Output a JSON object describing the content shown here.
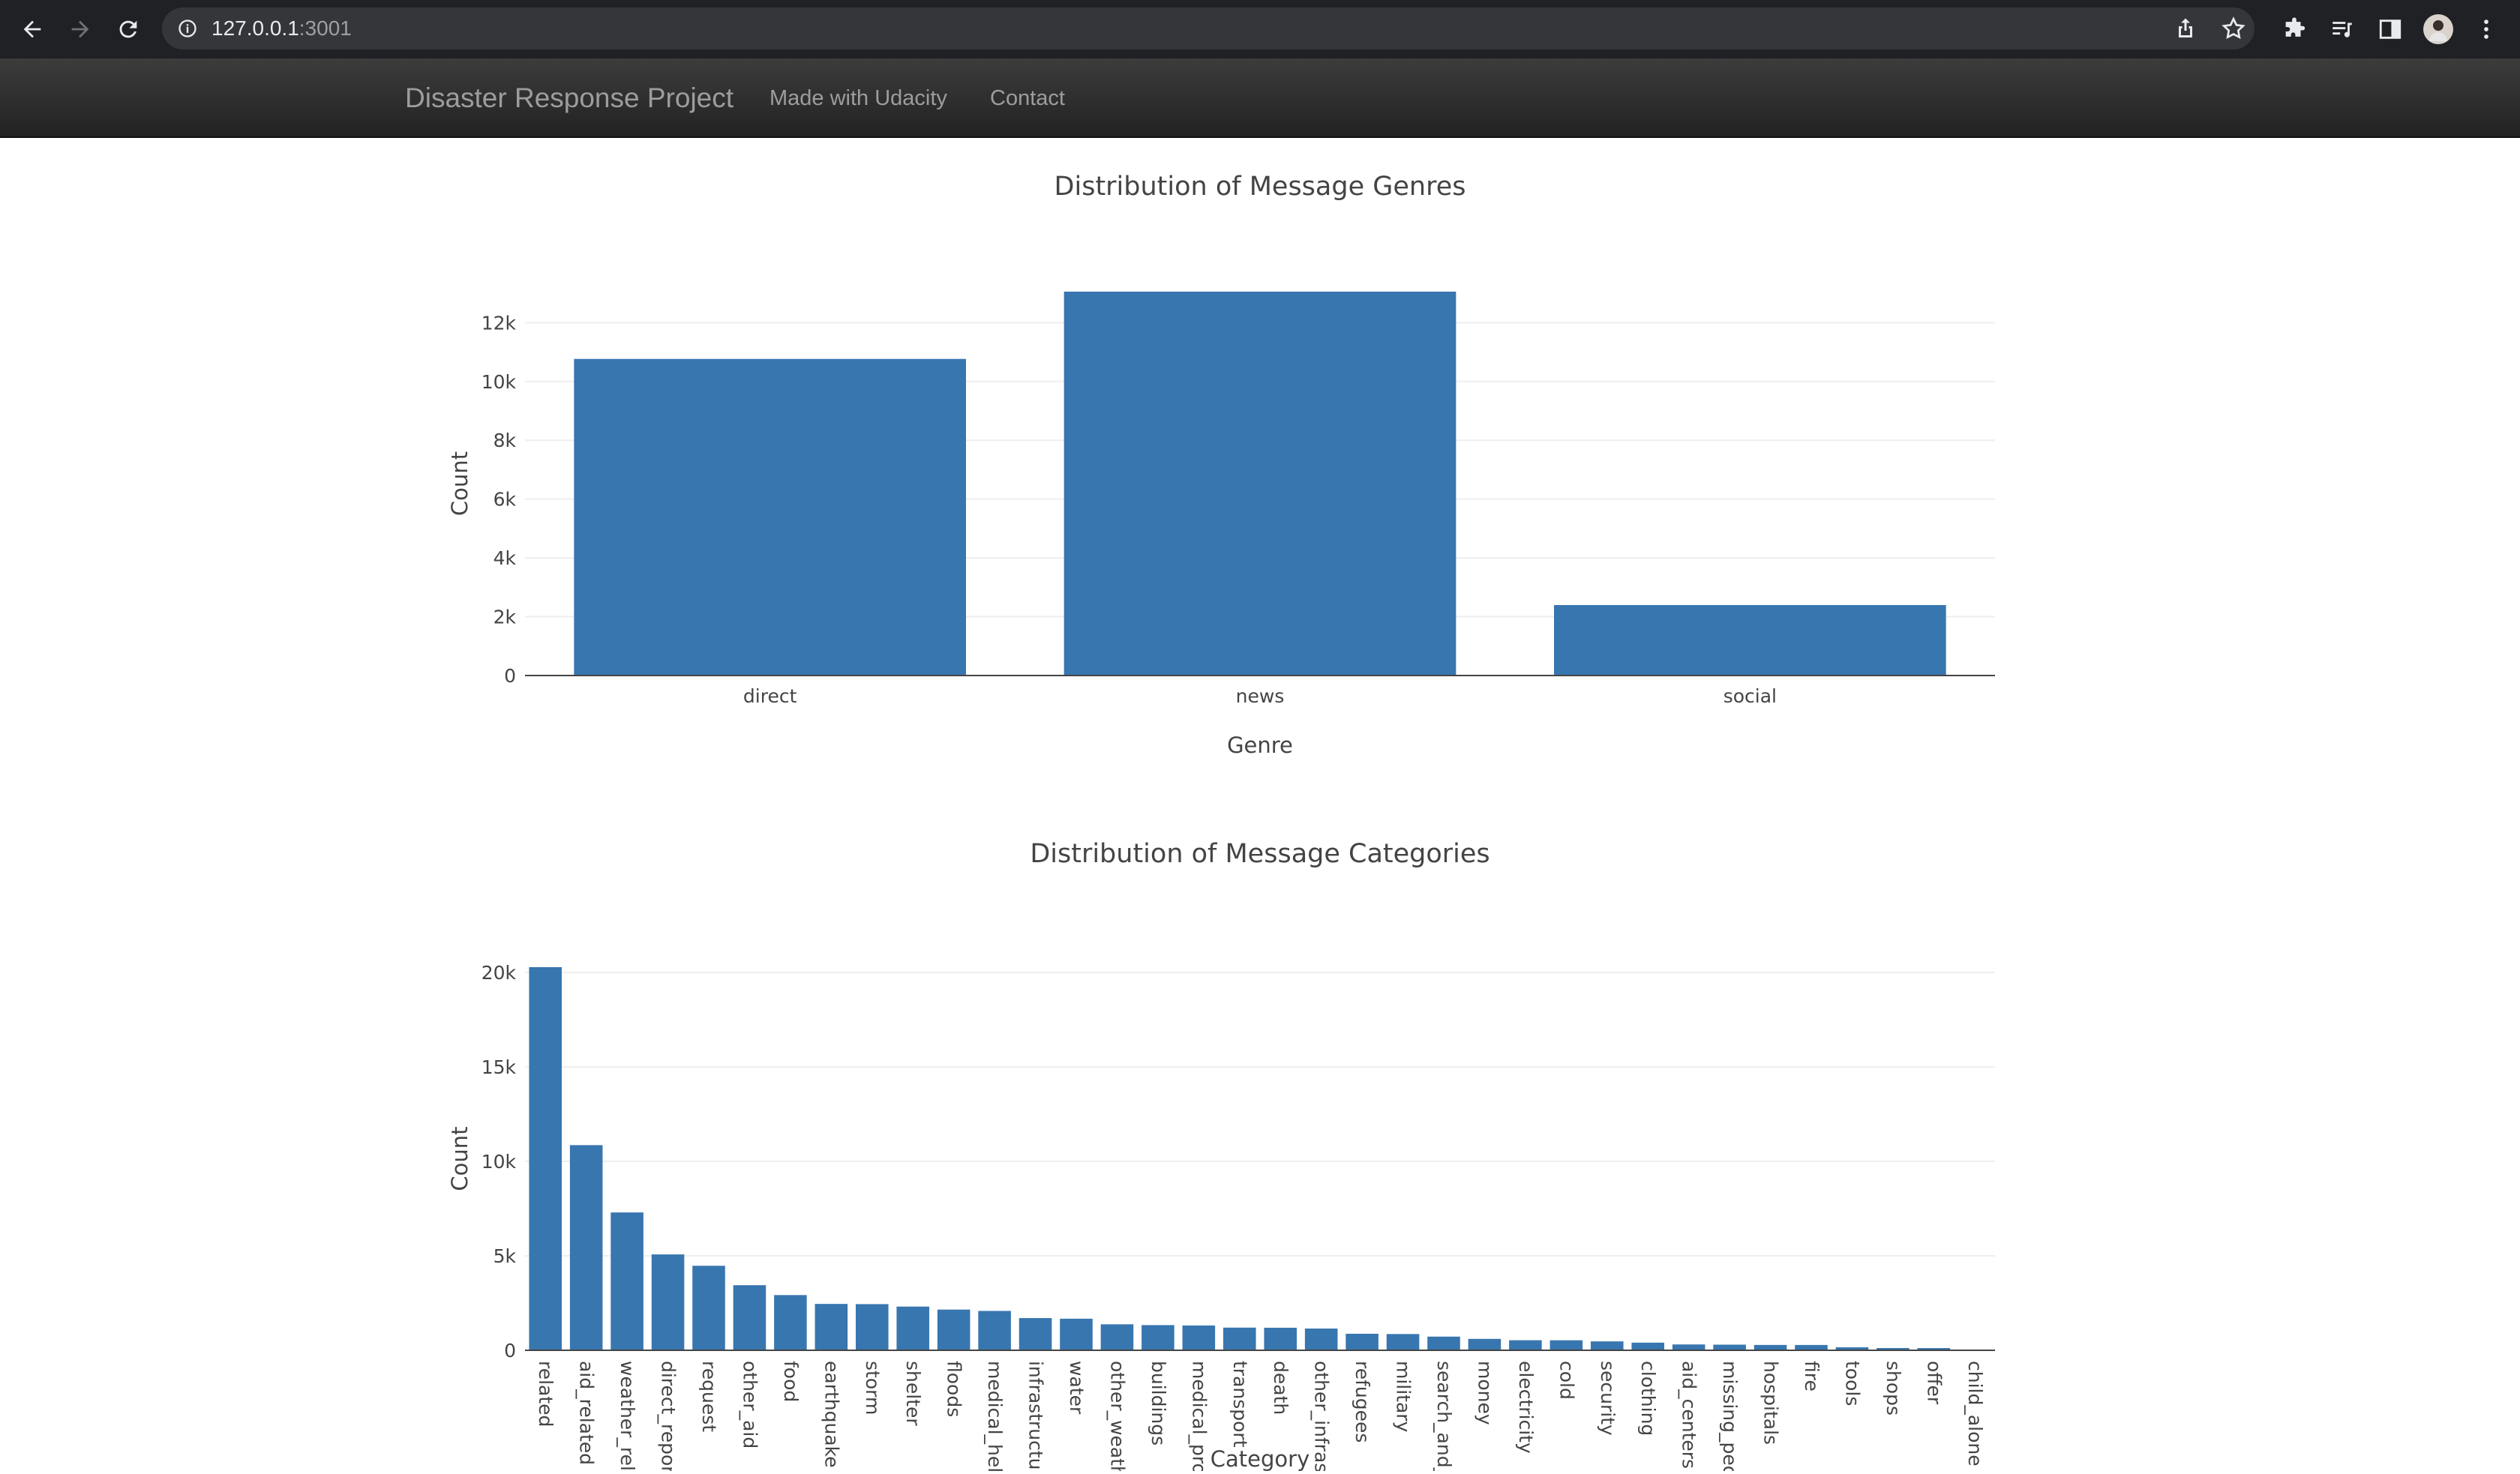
{
  "browser": {
    "url_host": "127.0.0.1",
    "url_port": ":3001",
    "icons": [
      "back-arrow-icon",
      "forward-arrow-icon",
      "reload-icon",
      "info-icon",
      "share-icon",
      "star-icon",
      "extensions-icon",
      "media-icon",
      "sidepanel-icon",
      "profile-avatar",
      "menu-dots-icon"
    ]
  },
  "navbar": {
    "brand": "Disaster Response Project",
    "links": [
      "Made with Udacity",
      "Contact"
    ]
  },
  "colors": {
    "bar": "#3876af",
    "grid": "#eeeeee",
    "axis": "#444444"
  },
  "chart_data": [
    {
      "type": "bar",
      "title": "Distribution of Message Genres",
      "xlabel": "Genre",
      "ylabel": "Count",
      "categories": [
        "direct",
        "news",
        "social"
      ],
      "values": [
        10766,
        13054,
        2396
      ],
      "ylim": [
        0,
        13054
      ],
      "yticks": [
        0,
        2000,
        4000,
        6000,
        8000,
        10000,
        12000
      ],
      "ytick_labels": [
        "0",
        "2k",
        "4k",
        "6k",
        "8k",
        "10k",
        "12k"
      ],
      "grid": true
    },
    {
      "type": "bar",
      "title": "Distribution of Message Categories",
      "xlabel": "Category",
      "ylabel": "Count",
      "categories": [
        "related",
        "aid_related",
        "weather_related",
        "direct_report",
        "request",
        "other_aid",
        "food",
        "earthquake",
        "storm",
        "shelter",
        "floods",
        "medical_help",
        "infrastructure_related",
        "water",
        "other_weather",
        "buildings",
        "medical_products",
        "transport",
        "death",
        "other_infrastructure",
        "refugees",
        "military",
        "search_and_rescue",
        "money",
        "electricity",
        "cold",
        "security",
        "clothing",
        "aid_centers",
        "missing_people",
        "hospitals",
        "fire",
        "tools",
        "shops",
        "offer",
        "child_alone"
      ],
      "tick_labels": [
        "related",
        "aid_related",
        "weather_rel",
        "direct_repor",
        "request",
        "other_aid",
        "food",
        "earthquake",
        "storm",
        "shelter",
        "floods",
        "medical_hel",
        "infrastructur",
        "water",
        "other_weath",
        "buildings",
        "medical_pro",
        "transport",
        "death",
        "other_infras",
        "refugees",
        "military",
        "search_and_",
        "money",
        "electricity",
        "cold",
        "security",
        "clothing",
        "aid_centers",
        "missing_peo",
        "hospitals",
        "fire",
        "tools",
        "shops",
        "offer",
        "child_alone"
      ],
      "values": [
        20282,
        10860,
        7297,
        5075,
        4474,
        3446,
        2923,
        2455,
        2443,
        2314,
        2155,
        2084,
        1705,
        1672,
        1376,
        1333,
        1313,
        1201,
        1194,
        1151,
        875,
        860,
        724,
        604,
        532,
        530,
        471,
        405,
        309,
        298,
        283,
        282,
        159,
        120,
        118,
        0
      ],
      "ylim": [
        0,
        20282
      ],
      "yticks": [
        0,
        5000,
        10000,
        15000,
        20000
      ],
      "ytick_labels": [
        "0",
        "5k",
        "10k",
        "15k",
        "20k"
      ],
      "grid": true
    }
  ]
}
